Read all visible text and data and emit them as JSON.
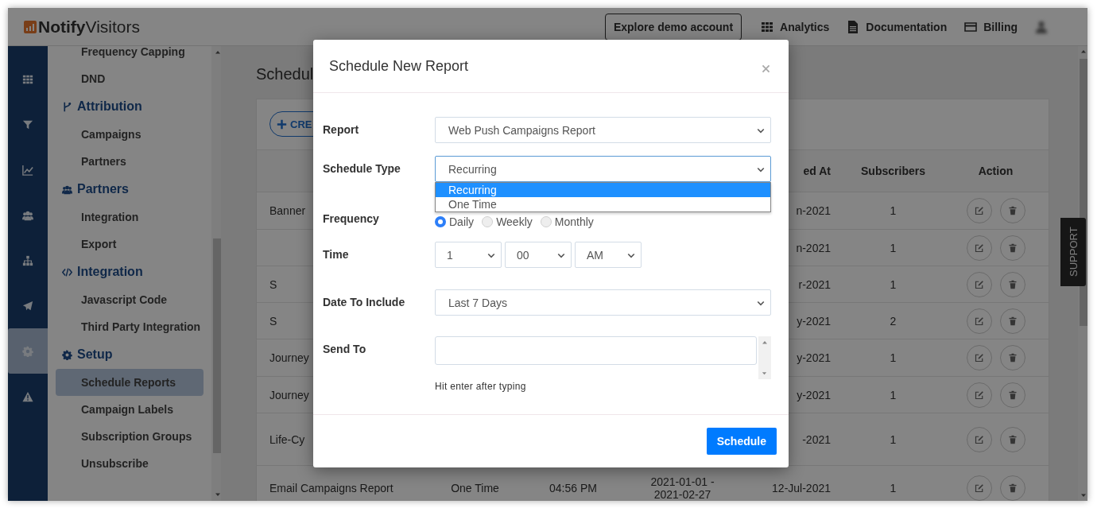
{
  "header": {
    "brand": "**Notify**Visitors",
    "demo_button": "Explore demo account",
    "nav": [
      {
        "label": "Analytics"
      },
      {
        "label": "Documentation"
      },
      {
        "label": "Billing"
      }
    ]
  },
  "rail": [
    {
      "selected": false
    },
    {
      "selected": false
    },
    {
      "selected": false
    },
    {
      "selected": false
    },
    {
      "selected": false
    },
    {
      "selected": false
    },
    {
      "selected": true
    },
    {
      "selected": false
    }
  ],
  "sidebar": {
    "items": [
      {
        "kind": "item",
        "label": "Frequency Capping",
        "selected": false
      },
      {
        "kind": "item",
        "label": "DND",
        "selected": false
      },
      {
        "kind": "section",
        "label": "Attribution"
      },
      {
        "kind": "item",
        "label": "Campaigns",
        "selected": false
      },
      {
        "kind": "item",
        "label": "Partners",
        "selected": false
      },
      {
        "kind": "section",
        "label": "Partners"
      },
      {
        "kind": "item",
        "label": "Integration",
        "selected": false
      },
      {
        "kind": "item",
        "label": "Export",
        "selected": false
      },
      {
        "kind": "section",
        "label": "Integration"
      },
      {
        "kind": "item",
        "label": "Javascript Code",
        "selected": false
      },
      {
        "kind": "item",
        "label": "Third Party Integration",
        "selected": false
      },
      {
        "kind": "section",
        "label": "Setup"
      },
      {
        "kind": "item",
        "label": "Schedule Reports",
        "selected": true
      },
      {
        "kind": "item",
        "label": "Campaign Labels",
        "selected": false
      },
      {
        "kind": "item",
        "label": "Subscription Groups",
        "selected": false
      },
      {
        "kind": "item",
        "label": "Unsubscribe",
        "selected": false
      }
    ]
  },
  "page": {
    "title": "Schedul",
    "create_button": "CRE",
    "table": {
      "columns": [
        "ed At",
        "Subscribers",
        "Action"
      ],
      "rows": [
        {
          "name": "Banner",
          "created": "n-2021",
          "subscribers": "1"
        },
        {
          "created": "n-2021",
          "subscribers": "1"
        },
        {
          "name": "S",
          "created": "r-2021",
          "subscribers": "1"
        },
        {
          "name": "S",
          "created": "y-2021",
          "subscribers": "2"
        },
        {
          "name": "Journey",
          "created": "y-2021",
          "subscribers": "1"
        },
        {
          "name": "Journey",
          "created": "y-2021",
          "subscribers": "1"
        },
        {
          "name": "Life-Cy",
          "created": "-2021",
          "subscribers": "1"
        },
        {
          "name": "Email Campaigns Report",
          "type": "One Time",
          "time": "04:56 PM",
          "range": "2021-01-01 - 2021-02-27",
          "created": "12-Jul-2021",
          "subscribers": "1"
        }
      ]
    }
  },
  "support_tab": "SUPPORT",
  "modal": {
    "title": "Schedule New Report",
    "fields": {
      "report_label": "Report",
      "report": "Web Push Campaigns Report",
      "schedule_type_label": "Schedule Type",
      "schedule_type": {
        "value": "Recurring",
        "open": true,
        "options": [
          {
            "label": "Recurring",
            "selected": true
          },
          {
            "label": "One Time",
            "selected": false
          }
        ]
      },
      "frequency_label": "Frequency",
      "frequency": [
        {
          "label": "Daily",
          "selected": true
        },
        {
          "label": "Weekly",
          "selected": false
        },
        {
          "label": "Monthly",
          "selected": false
        }
      ],
      "time_label": "Time",
      "time": [
        "1",
        "00",
        "AM"
      ],
      "date_label": "Date To Include",
      "date": "Last 7 Days",
      "send_to_label": "Send To",
      "send_to_hint": "Hit enter after typing"
    },
    "submit_button": "Schedule"
  }
}
